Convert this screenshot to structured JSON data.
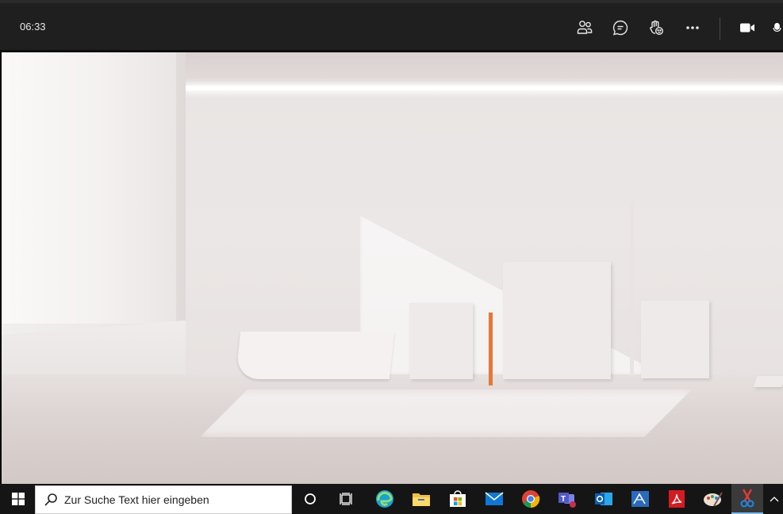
{
  "meeting": {
    "timer": "06:33",
    "controls": [
      {
        "name": "participants-icon",
        "label": "People"
      },
      {
        "name": "chat-icon",
        "label": "Chat"
      },
      {
        "name": "reactions-icon",
        "label": "Reactions"
      },
      {
        "name": "more-options-icon",
        "label": "More"
      },
      {
        "name": "camera-icon",
        "label": "Camera"
      },
      {
        "name": "microphone-icon",
        "label": "Mic"
      }
    ]
  },
  "taskbar": {
    "search_placeholder": "Zur Suche Text hier eingeben",
    "apps": [
      "Edge",
      "File Explorer",
      "Microsoft Store",
      "Mail",
      "Chrome",
      "Teams",
      "Outlook",
      "Microsoft Visio",
      "Adobe Acrobat",
      "Paint",
      "Snipping Tool"
    ],
    "accent": "#76b9ed"
  }
}
